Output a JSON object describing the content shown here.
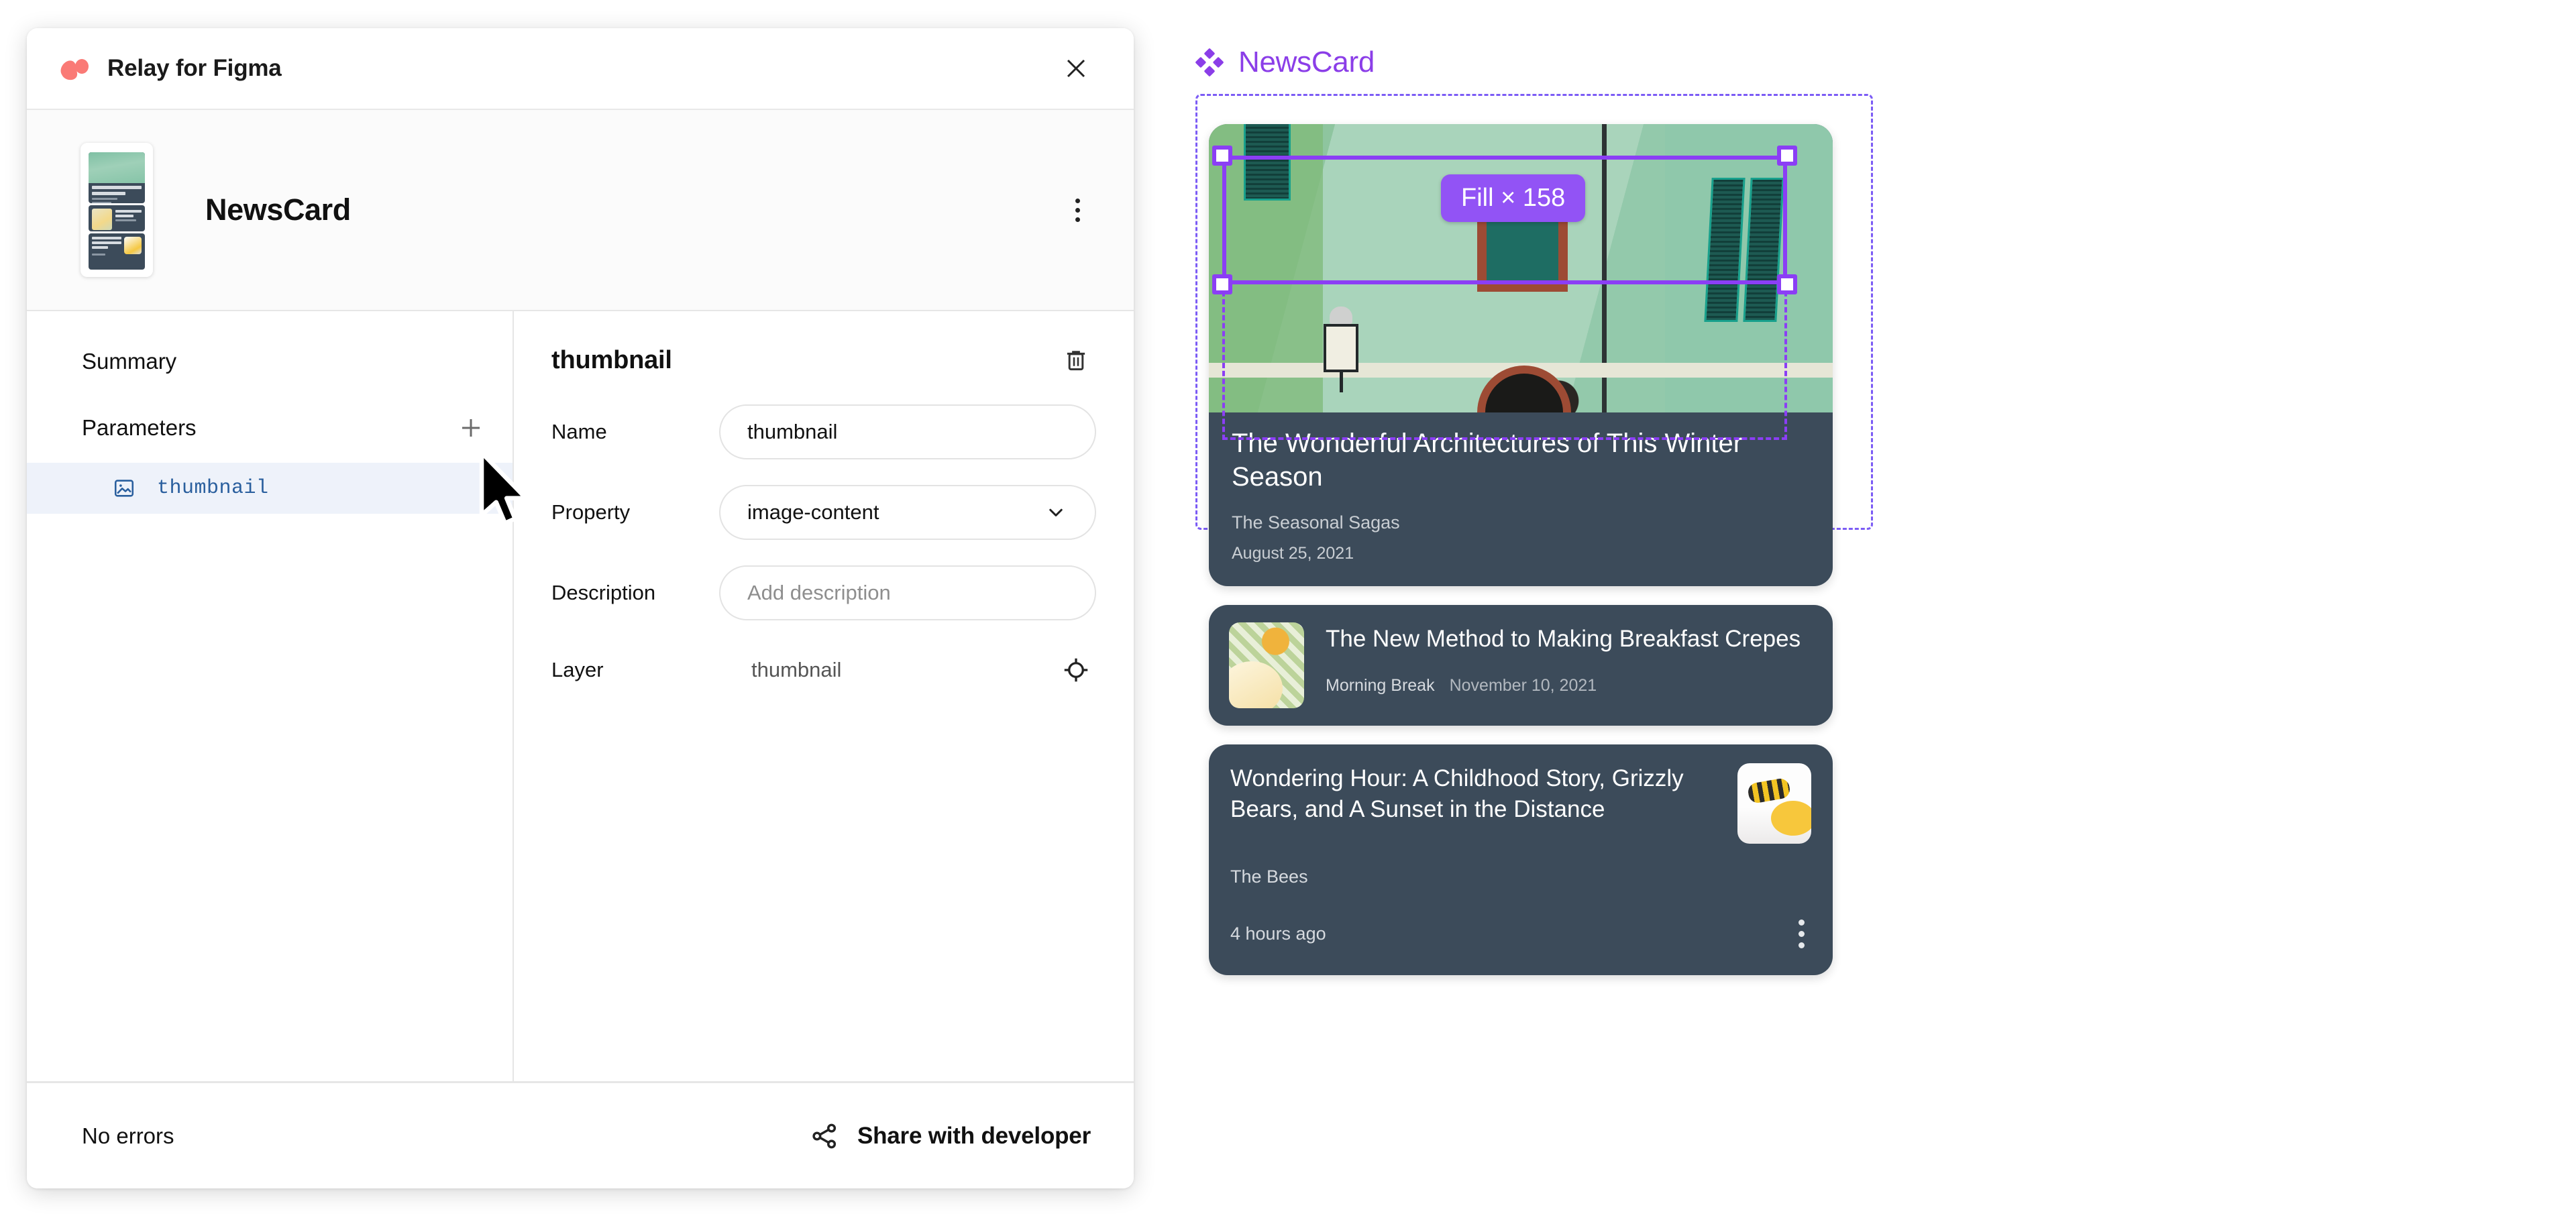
{
  "plugin": {
    "title": "Relay for Figma",
    "logo_icon": "relay-logo-icon",
    "close_icon": "close-icon",
    "component": {
      "name": "NewsCard",
      "thumbnail_icon": "component-thumbnail-preview",
      "overflow_icon": "kebab-menu-icon"
    },
    "left": {
      "summary_label": "Summary",
      "parameters_label": "Parameters",
      "add_icon": "plus-icon",
      "parameters": [
        {
          "name": "thumbnail",
          "type_icon": "image-icon",
          "selected": true
        }
      ]
    },
    "detail": {
      "heading": "thumbnail",
      "delete_icon": "trash-icon",
      "fields": [
        {
          "label": "Name",
          "value": "thumbnail",
          "control": "text"
        },
        {
          "label": "Property",
          "value": "image-content",
          "control": "select",
          "chevron_icon": "chevron-down-icon"
        },
        {
          "label": "Description",
          "value": "",
          "placeholder": "Add description",
          "control": "text"
        },
        {
          "label": "Layer",
          "value": "thumbnail",
          "control": "static",
          "locate_icon": "target-crosshair-icon"
        }
      ]
    },
    "footer": {
      "status": "No errors",
      "share_label": "Share with developer",
      "share_icon": "share-icon"
    }
  },
  "canvas": {
    "component_label": "NewsCard",
    "component_icon": "figma-component-diamond-icon",
    "selection": {
      "badge": "Fill × 158",
      "accent_color": "#8b3ef5",
      "frame_border_color": "#7c5cf5",
      "handle_icon": "resize-handle"
    },
    "cards": [
      {
        "title": "The Wonderful Architectures of This Winter Season",
        "source": "The Seasonal Sagas",
        "date": "August 25, 2021",
        "image_icon": "green-building-photo",
        "layout": "image-top"
      },
      {
        "title": "The New Method to Making Breakfast Crepes",
        "source": "Morning Break",
        "date": "November 10, 2021",
        "image_icon": "breakfast-crepes-photo",
        "layout": "thumbnail-left"
      },
      {
        "title": "Wondering Hour: A Childhood Story, Grizzly Bears, and A Sunset in the Distance",
        "source": "The Bees",
        "date": "4 hours ago",
        "image_icon": "bee-photo",
        "layout": "thumbnail-right",
        "overflow_icon": "kebab-menu-icon"
      }
    ]
  },
  "colors": {
    "relay_pink": "#fa7a76",
    "card_bg": "#3c4b5a",
    "purple_accent": "#8b3ef5",
    "badge_purple": "#9253f5",
    "param_row_bg": "#eef2fa",
    "param_text_blue": "#2a5f9e"
  }
}
